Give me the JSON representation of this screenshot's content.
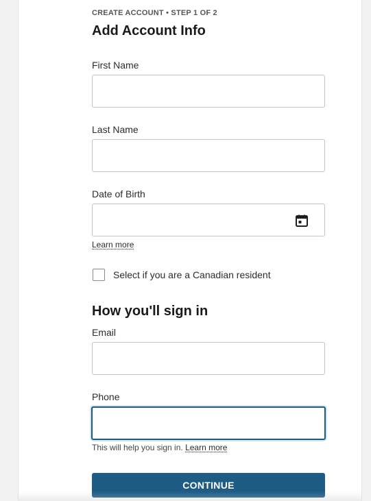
{
  "header": {
    "step_label": "CREATE ACCOUNT • STEP 1 OF 2",
    "title": "Add Account Info"
  },
  "form": {
    "first_name": {
      "label": "First Name",
      "value": "",
      "placeholder": ""
    },
    "last_name": {
      "label": "Last Name",
      "value": "",
      "placeholder": ""
    },
    "date_of_birth": {
      "label": "Date of Birth",
      "value": "",
      "placeholder": "",
      "icon": "calendar-icon",
      "learn_more": "Learn more"
    },
    "canadian_resident": {
      "label": "Select if you are a Canadian resident",
      "checked": false
    }
  },
  "sign_in": {
    "title": "How you'll sign in",
    "email": {
      "label": "Email",
      "value": "",
      "placeholder": ""
    },
    "phone": {
      "label": "Phone",
      "value": "",
      "placeholder": "",
      "focused": true,
      "helper": "This will help you sign in.",
      "learn_more": "Learn more"
    }
  },
  "actions": {
    "continue_label": "CONTINUE"
  },
  "colors": {
    "primary_button": "#1f5c85",
    "focus_border": "#1b5a80",
    "page_background": "#f2f2f2",
    "card_background": "#ffffff"
  }
}
